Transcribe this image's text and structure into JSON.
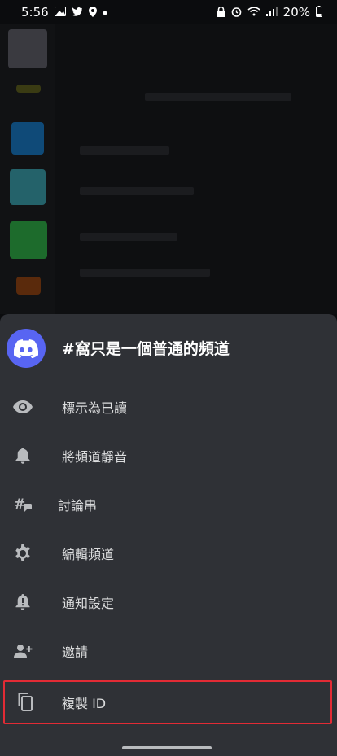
{
  "status_bar": {
    "time": "5:56",
    "battery": "20%",
    "left_icons": [
      "gallery-icon",
      "twitter-icon",
      "location-icon",
      "dot-icon"
    ],
    "right_icons": [
      "lock-icon",
      "alarm-icon",
      "wifi-icon",
      "signal-icon",
      "battery-icon"
    ]
  },
  "sheet": {
    "channel_title": "#窩只是一個普通的頻道",
    "items": [
      {
        "label": "標示為已讀",
        "icon": "eye-icon"
      },
      {
        "label": "將頻道靜音",
        "icon": "bell-icon"
      },
      {
        "label": "討論串",
        "icon": "threads-icon"
      },
      {
        "label": "編輯頻道",
        "icon": "gear-icon"
      },
      {
        "label": "通知設定",
        "icon": "bell-alert-icon"
      },
      {
        "label": "邀請",
        "icon": "add-person-icon"
      },
      {
        "label": "複製 ID",
        "icon": "copy-icon"
      }
    ]
  },
  "colors": {
    "sheet_bg": "#2f3136",
    "accent": "#5865f2",
    "highlight_border": "#e22b35"
  }
}
